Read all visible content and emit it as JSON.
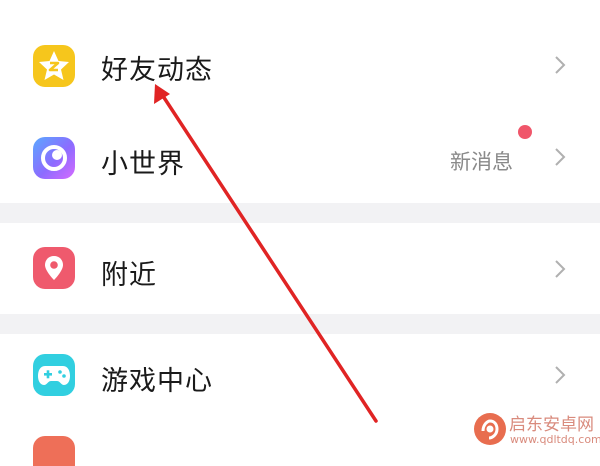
{
  "menu": {
    "items": [
      {
        "label": "好友动态",
        "icon": "qzone-star-icon"
      },
      {
        "label": "小世界",
        "icon": "small-world-icon",
        "badge_text": "新消息",
        "dot_color": "#f0566a"
      },
      {
        "label": "附近",
        "icon": "location-pin-icon"
      },
      {
        "label": "游戏中心",
        "icon": "gamepad-icon"
      }
    ]
  },
  "watermark": {
    "cn": "启东安卓网",
    "en": "www.qdltdq.com"
  },
  "colors": {
    "arrow": "#e02424",
    "separator": "#f2f2f4"
  }
}
